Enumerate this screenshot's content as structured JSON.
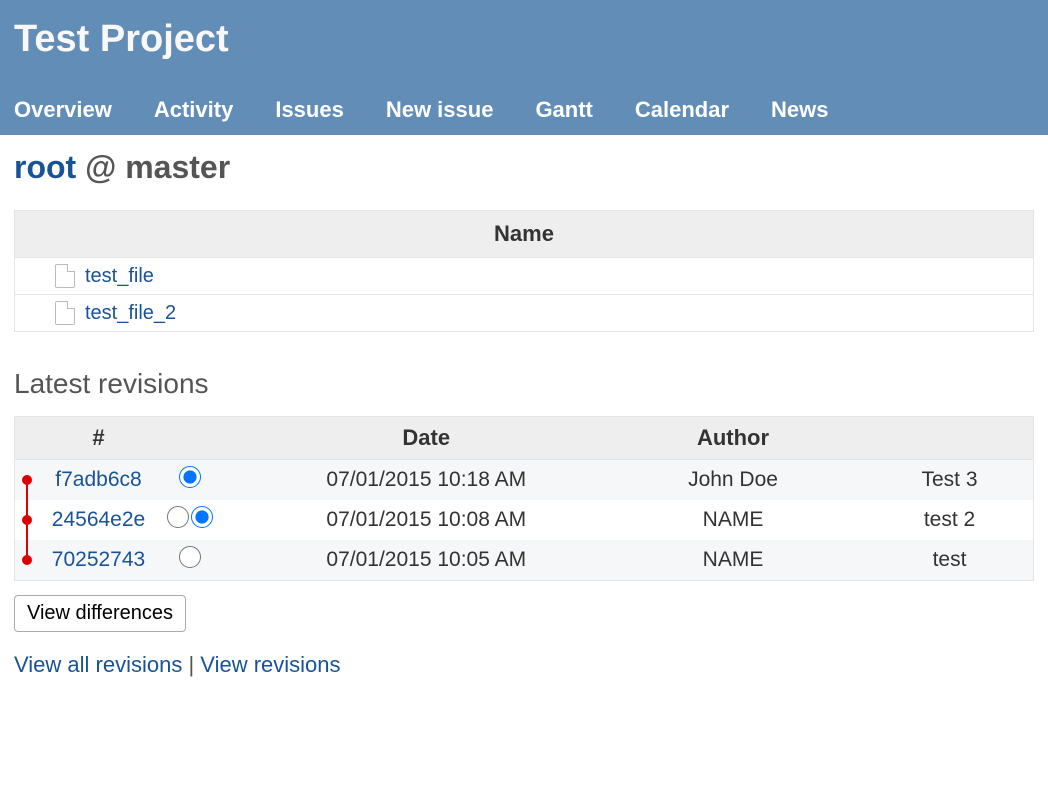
{
  "header": {
    "project_title": "Test Project",
    "menu": [
      "Overview",
      "Activity",
      "Issues",
      "New issue",
      "Gantt",
      "Calendar",
      "News"
    ]
  },
  "breadcrumb": {
    "root": "root",
    "sep": " @ ",
    "branch": "master"
  },
  "files": {
    "columns": [
      "Name"
    ],
    "rows": [
      {
        "name": "test_file"
      },
      {
        "name": "test_file_2"
      }
    ]
  },
  "revisions": {
    "title": "Latest revisions",
    "columns": {
      "hash": "#",
      "date": "Date",
      "author": "Author"
    },
    "rows": [
      {
        "hash": "f7adb6c8",
        "date": "07/01/2015 10:18 AM",
        "author": "John Doe",
        "message": "Test 3",
        "from_selected": true,
        "to_visible": false,
        "to_selected": false
      },
      {
        "hash": "24564e2e",
        "date": "07/01/2015 10:08 AM",
        "author": "NAME",
        "message": "test 2",
        "from_selected": false,
        "to_visible": true,
        "to_selected": true
      },
      {
        "hash": "70252743",
        "date": "07/01/2015 10:05 AM",
        "author": "NAME",
        "message": "test",
        "from_selected": false,
        "to_visible": true,
        "to_selected": false
      }
    ],
    "view_diff_button": "View differences"
  },
  "bottom_links": {
    "all": "View all revisions",
    "sep": " | ",
    "view": "View revisions"
  }
}
